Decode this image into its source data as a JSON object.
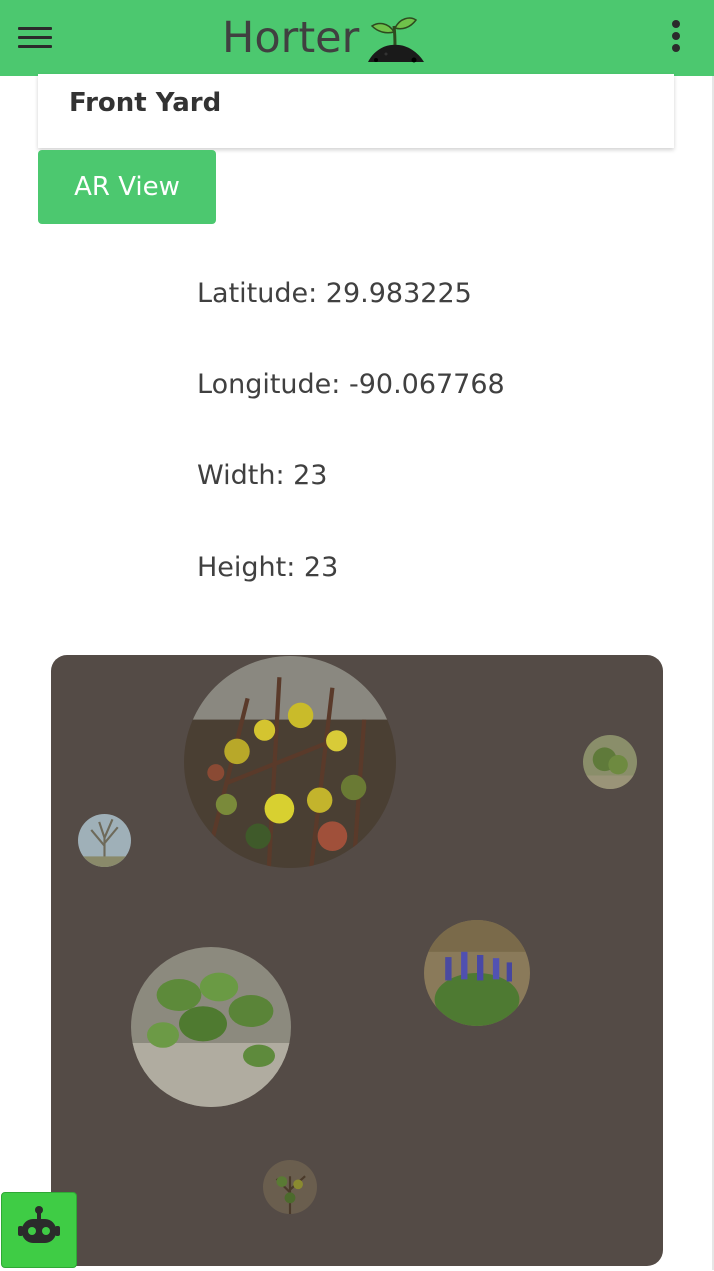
{
  "app": {
    "title": "Horter",
    "accent_color": "#4cc86f",
    "menu_icon": "hamburger-menu-icon",
    "logo_icon": "sprout-in-soil-icon",
    "more_icon": "vertical-dots-icon"
  },
  "yard": {
    "name": "Front Yard"
  },
  "ar_button": {
    "label": "AR View"
  },
  "details": {
    "latitude": "Latitude: 29.983225",
    "longitude": "Longitude: -90.067768",
    "width": "Width: 23",
    "height": "Height: 23"
  },
  "garden_map": {
    "background_color": "#544b46",
    "plants": [
      {
        "photo": "yellow-flowering-shrub"
      },
      {
        "photo": "small-green-shrub"
      },
      {
        "photo": "bare-branch-tree"
      },
      {
        "photo": "purple-flower-clump"
      },
      {
        "photo": "leafy-groundcover"
      },
      {
        "photo": "small-shrub-seedling"
      }
    ]
  },
  "assistant_button": {
    "icon": "robot-icon",
    "color": "#3fcc45"
  }
}
